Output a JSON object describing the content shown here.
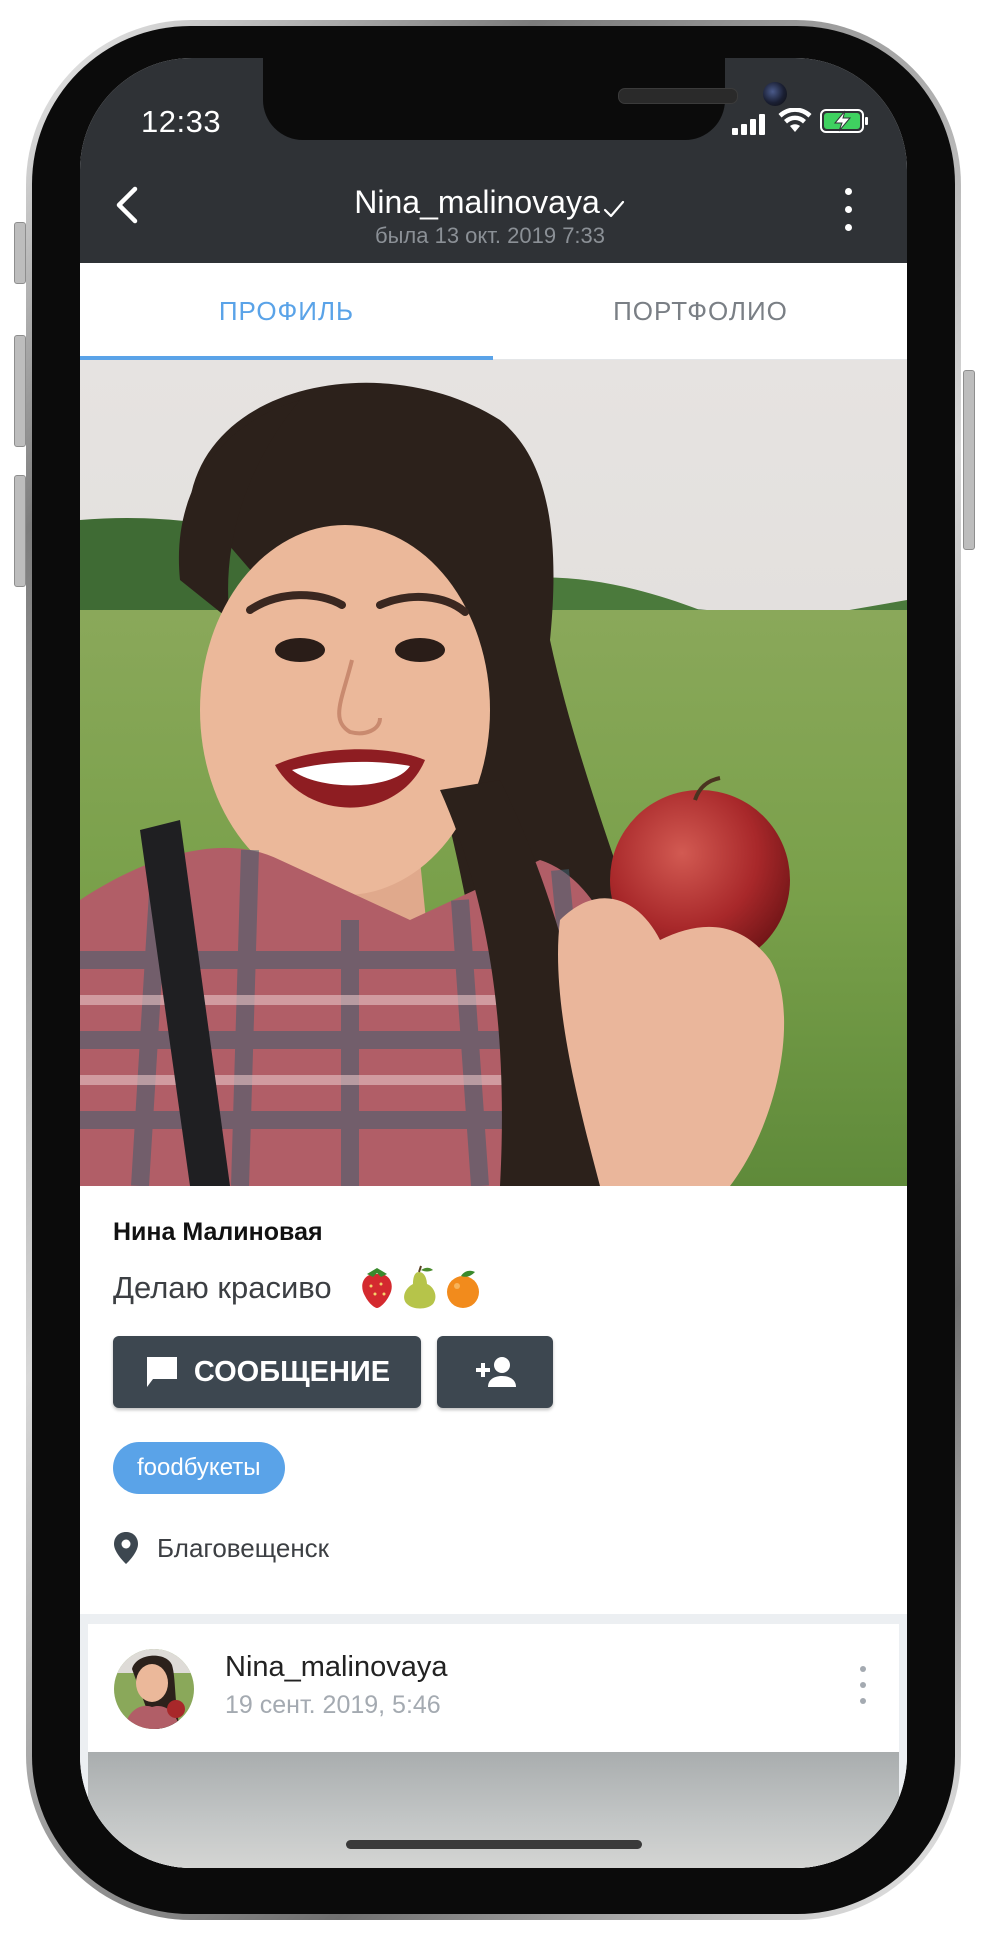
{
  "status_bar": {
    "time": "12:33"
  },
  "header": {
    "username": "Nina_malinovaya",
    "last_seen": "была 13 окт. 2019 7:33"
  },
  "tabs": [
    {
      "label": "ПРОФИЛЬ",
      "active": true
    },
    {
      "label": "ПОРТФОЛИО",
      "active": false
    }
  ],
  "profile": {
    "display_name": "Нина Малиновая",
    "status": "Делаю красиво",
    "status_emojis": [
      "strawberry",
      "pear",
      "tangerine"
    ],
    "message_button_label": "СООБЩЕНИЕ",
    "tag": "foodбукеты",
    "location": "Благовещенск"
  },
  "post": {
    "username": "Nina_malinovaya",
    "date": "19 сент. 2019, 5:46"
  },
  "icons": {
    "back": "chevron-left-icon",
    "verified": "checkmark-icon",
    "menu": "more-vertical-icon",
    "message": "chat-bubble-icon",
    "add_friend": "person-add-icon",
    "location": "location-pin-icon"
  },
  "colors": {
    "header_bg": "#2f3236",
    "accent_blue": "#5aa3e8",
    "button_dark": "#3d4750",
    "tab_inactive": "#7a7f85",
    "muted_text": "#a4aab1"
  }
}
